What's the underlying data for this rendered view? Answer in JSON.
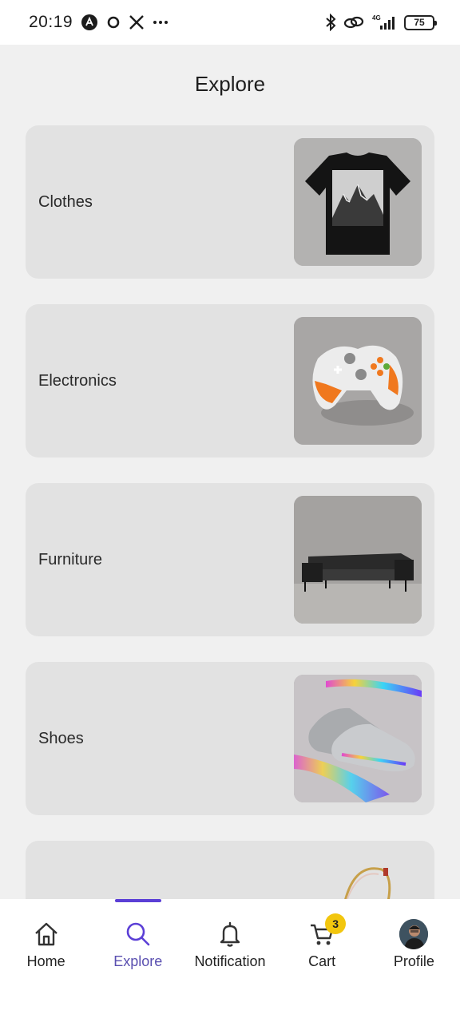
{
  "status_bar": {
    "time": "20:19",
    "left_icons": [
      "a-circle-icon",
      "ring-icon",
      "x-logo-icon",
      "more-dots-icon"
    ],
    "network": "4G",
    "battery": "75"
  },
  "header": {
    "title": "Explore"
  },
  "categories": [
    {
      "label": "Clothes",
      "image": "black-tshirt-mountain-print"
    },
    {
      "label": "Electronics",
      "image": "orange-white-game-controller"
    },
    {
      "label": "Furniture",
      "image": "black-leather-sofa"
    },
    {
      "label": "Shoes",
      "image": "silver-holographic-sneakers"
    },
    {
      "label": "",
      "image": "beaded-bracelet"
    }
  ],
  "bottom_nav": {
    "items": [
      {
        "label": "Home",
        "icon": "home-icon"
      },
      {
        "label": "Explore",
        "icon": "search-icon",
        "active": true
      },
      {
        "label": "Notification",
        "icon": "bell-icon"
      },
      {
        "label": "Cart",
        "icon": "cart-icon",
        "badge": "3"
      },
      {
        "label": "Profile",
        "icon": "avatar"
      }
    ]
  },
  "colors": {
    "accent": "#5b3fd6",
    "badge": "#f2c60e",
    "card_bg": "#e2e2e2",
    "page_bg": "#f0f0f0"
  }
}
